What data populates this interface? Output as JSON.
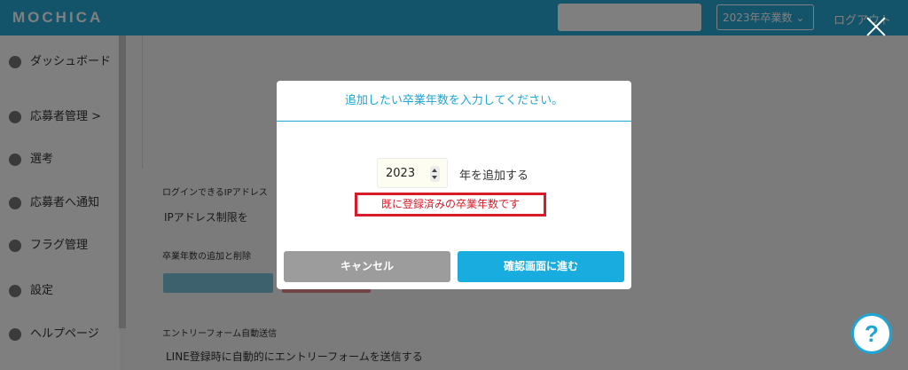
{
  "app": {
    "logo": "MOCHICA",
    "year_select": "2023年卒業数 ⌄",
    "logout": "ログアウト"
  },
  "sidebar": {
    "items": [
      {
        "label": "ダッシュボード"
      },
      {
        "label": "応募者管理 >"
      },
      {
        "label": "選考"
      },
      {
        "label": "応募者へ通知"
      },
      {
        "label": "フラグ管理"
      },
      {
        "label": "設定"
      },
      {
        "label": "ヘルプページ"
      }
    ]
  },
  "main": {
    "ip_label": "ログインできるIPアドレス",
    "ip_checkbox_label": "IPアドレス制限を",
    "year_section_label": "卒業年数の追加と削除",
    "entry_form_label": "エントリーフォーム自動送信",
    "line_checkbox_label": "LINE登録時に自動的にエントリーフォームを送信する"
  },
  "modal": {
    "title": "追加したい卒業年数を入力してください。",
    "year_value": "2023",
    "year_suffix": "年を追加する",
    "error": "既に登録済みの卒業年数です",
    "cancel_label": "キャンセル",
    "next_label": "確認画面に進む"
  },
  "help_label": "?",
  "colors": {
    "accent": "#1ea5d4",
    "error": "#d81b29",
    "cancel": "#9c9c9c",
    "primary_button": "#19addf"
  }
}
